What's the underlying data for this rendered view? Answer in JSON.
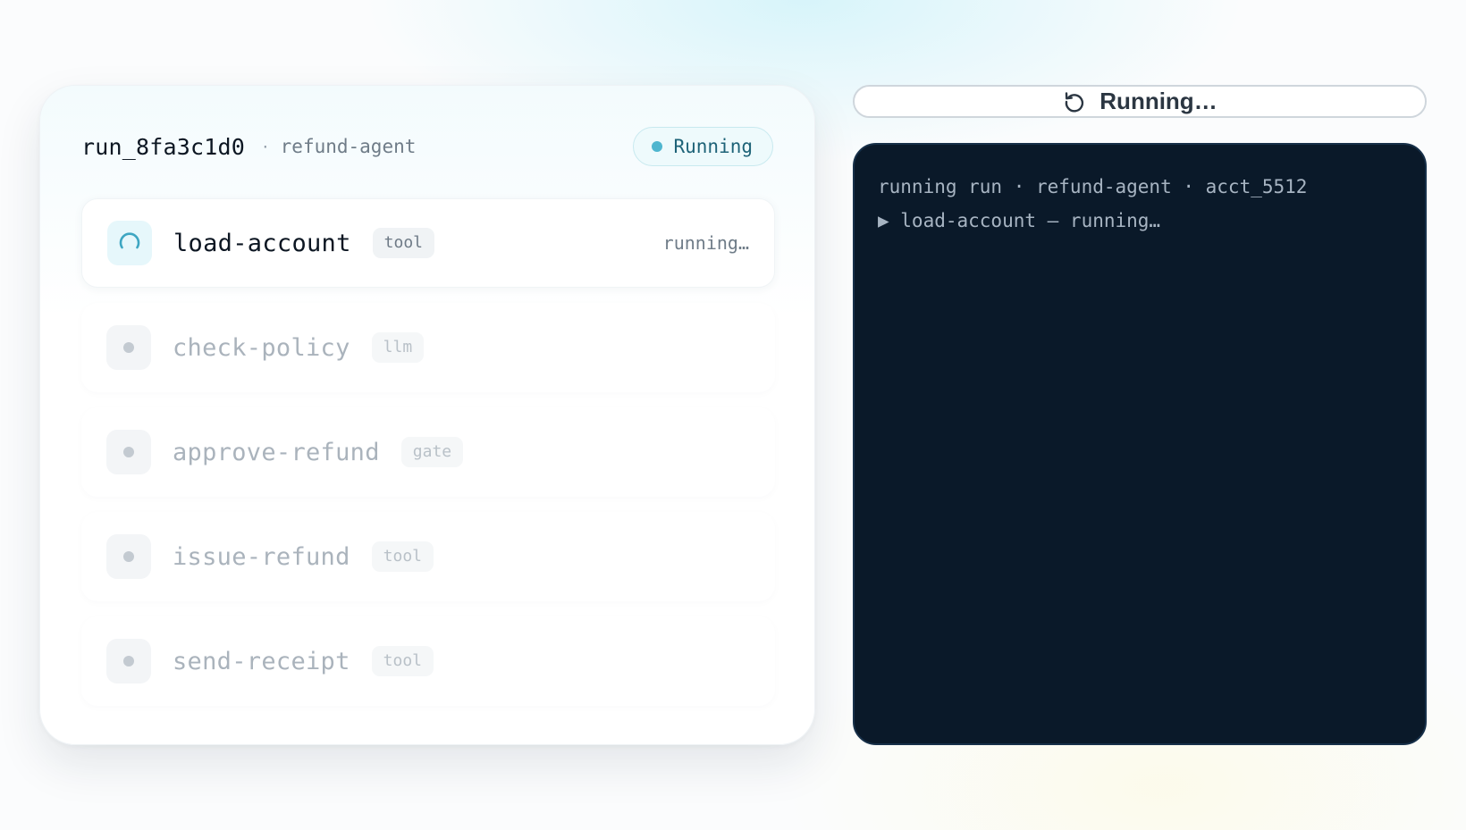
{
  "run": {
    "id": "run_8fa3c1d0",
    "separator": "·",
    "agent": "refund-agent",
    "status": "Running"
  },
  "steps": [
    {
      "name": "load-account",
      "tag": "tool",
      "state": "active",
      "status": "running…"
    },
    {
      "name": "check-policy",
      "tag": "llm",
      "state": "pending",
      "status": ""
    },
    {
      "name": "approve-refund",
      "tag": "gate",
      "state": "pending",
      "status": ""
    },
    {
      "name": "issue-refund",
      "tag": "tool",
      "state": "pending",
      "status": ""
    },
    {
      "name": "send-receipt",
      "tag": "tool",
      "state": "pending",
      "status": ""
    }
  ],
  "run_button": {
    "label": "Running…",
    "icon": "refresh-icon"
  },
  "terminal": {
    "lines": [
      "running run · refund-agent · acct_5512",
      "▶ load-account — running…"
    ]
  },
  "colors": {
    "accent": "#4fb6cf",
    "terminal_bg": "#0a1929",
    "text_primary": "#0c1622"
  }
}
